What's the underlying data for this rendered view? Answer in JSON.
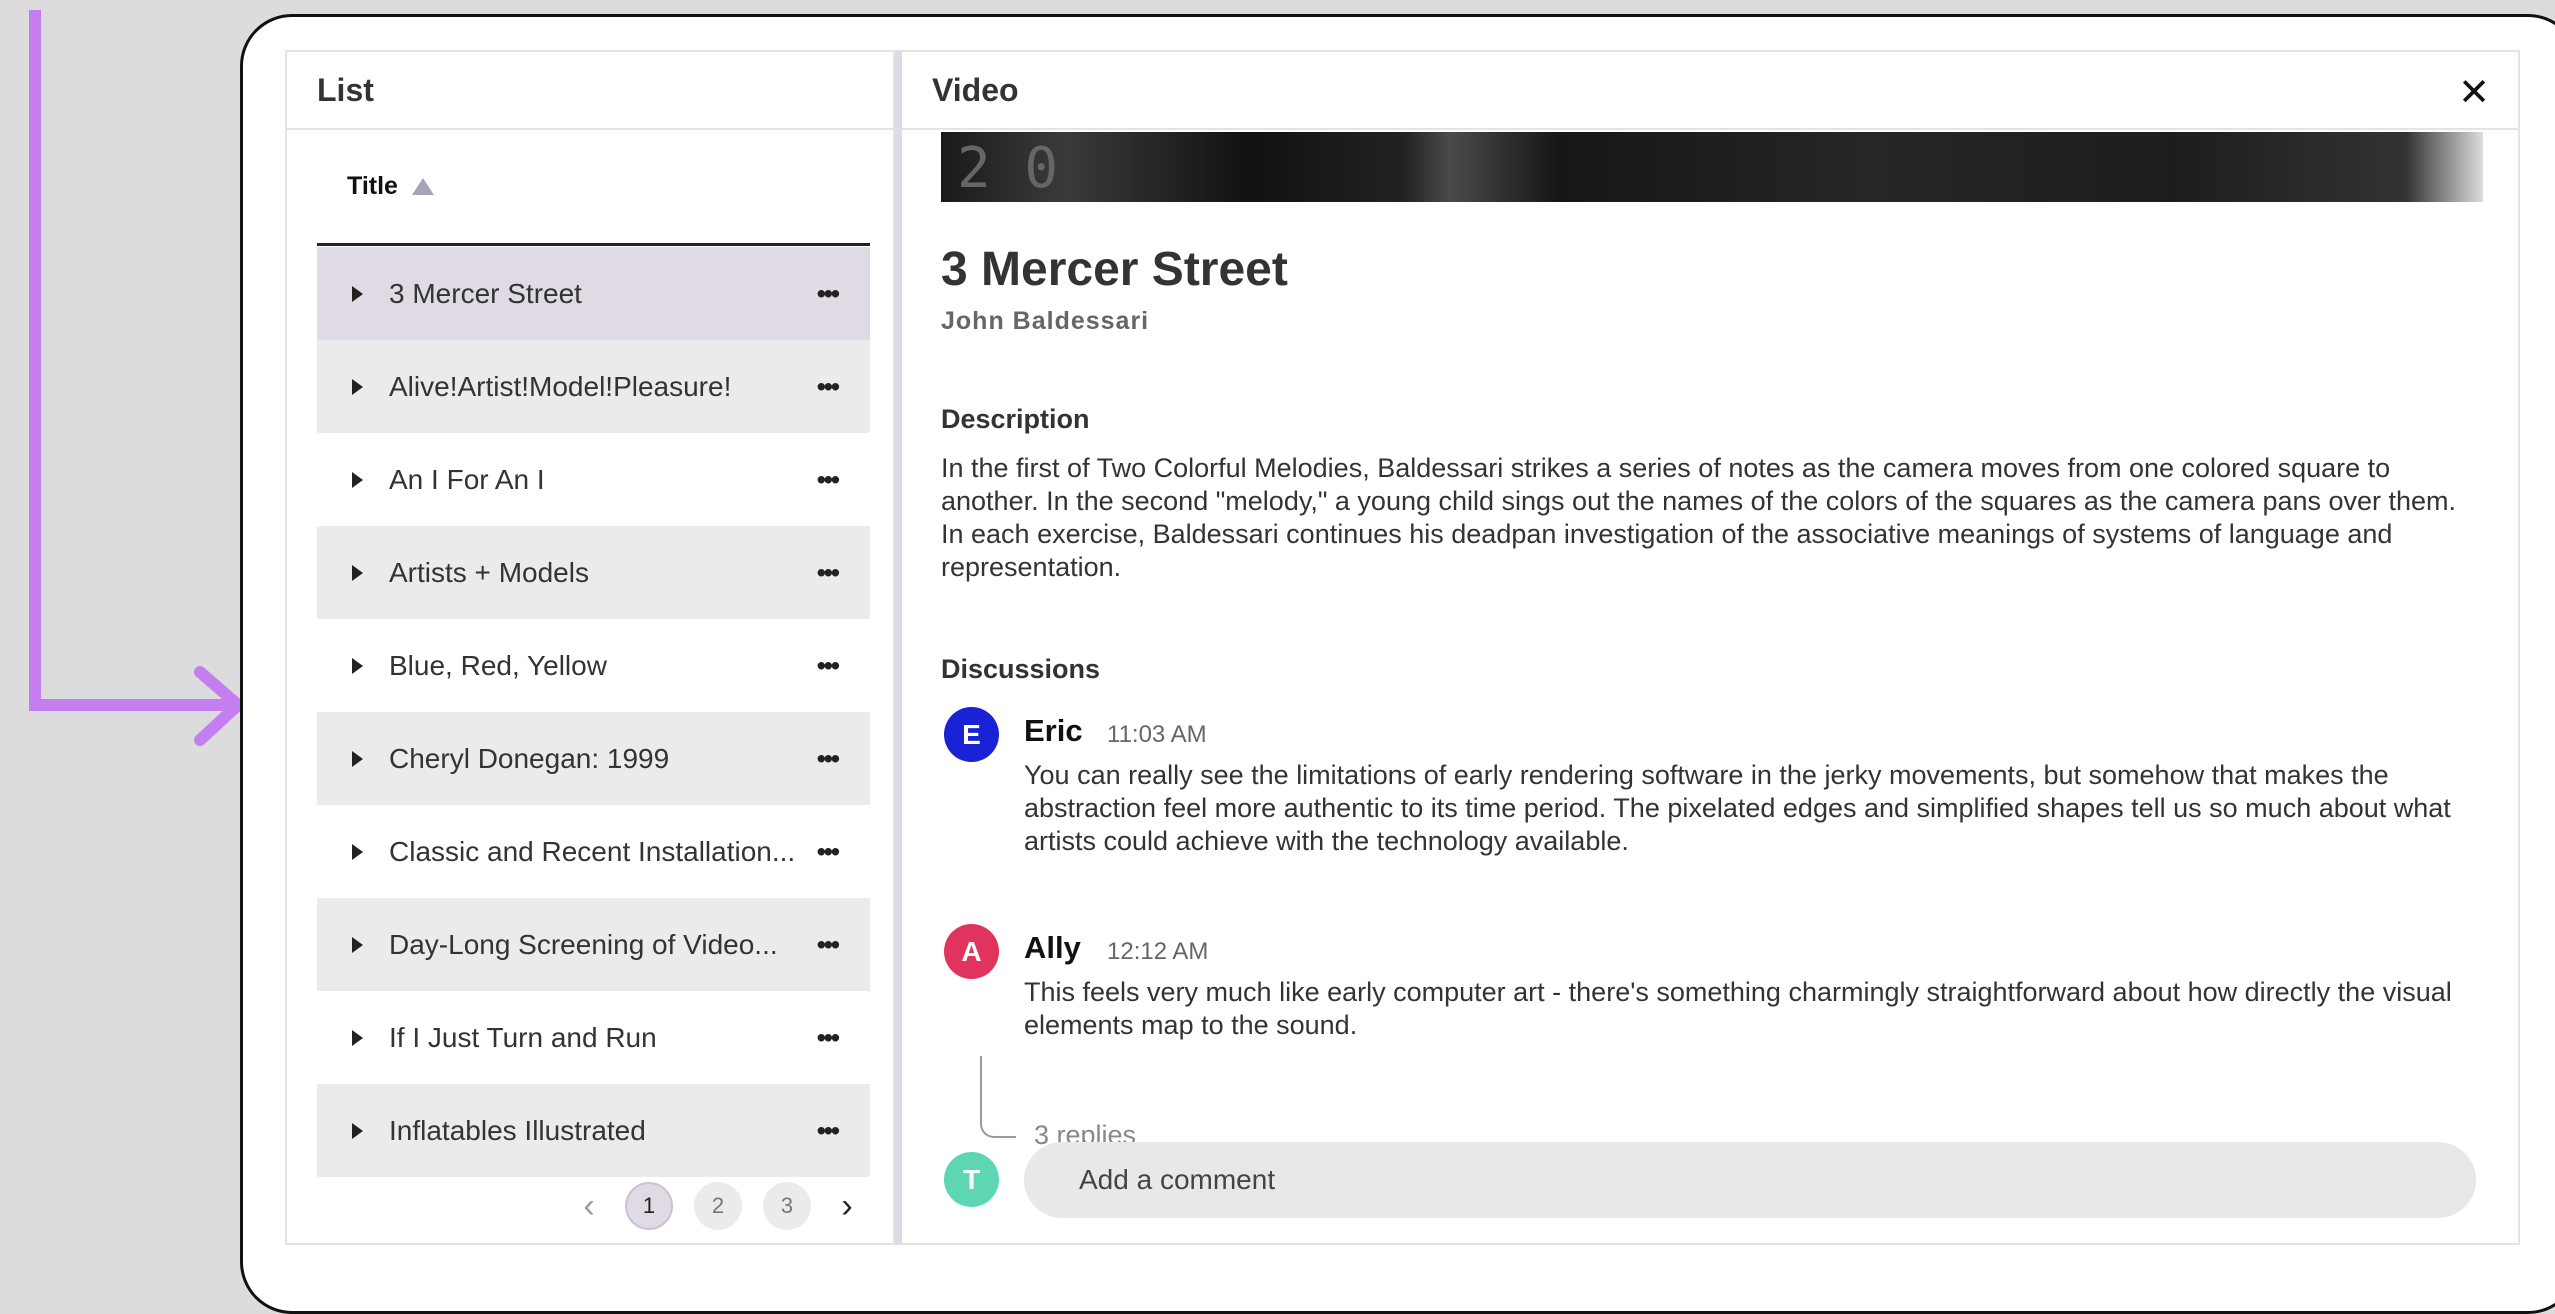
{
  "colors": {
    "arrow": "#c57ef0",
    "selected_row": "#dfdae4",
    "avatar_eric": "#1a22d6",
    "avatar_ally": "#e0345f",
    "avatar_user": "#5fd6b3"
  },
  "list_panel": {
    "title": "List",
    "column_header": "Title",
    "items": [
      {
        "label": "3 Mercer Street",
        "selected": true
      },
      {
        "label": "Alive!Artist!Model!Pleasure!"
      },
      {
        "label": "An I For An I"
      },
      {
        "label": "Artists + Models"
      },
      {
        "label": "Blue, Red, Yellow"
      },
      {
        "label": "Cheryl Donegan: 1999"
      },
      {
        "label": "Classic and Recent Installation..."
      },
      {
        "label": "Day-Long Screening of Video..."
      },
      {
        "label": "If I Just Turn and Run"
      },
      {
        "label": "Inflatables Illustrated"
      }
    ],
    "more_glyph": "•••",
    "pagination": {
      "pages": [
        "1",
        "2",
        "3"
      ],
      "current": "1",
      "prev": "‹",
      "next": "›"
    }
  },
  "video_panel": {
    "title": "Video",
    "close": "✕",
    "thumbnail_text": "2 0",
    "video_title": "3 Mercer Street",
    "artist": "John Baldessari",
    "description_heading": "Description",
    "description": "In the first of Two Colorful Melodies, Baldessari strikes a series of notes as the camera moves from one colored square to another. In the second \"melody,\" a young child sings out the names of the colors of the squares as the camera pans over them. In each exercise, Baldessari continues his deadpan investigation of the associative meanings of systems of language and representation.",
    "discussions_heading": "Discussions",
    "comments": [
      {
        "initial": "E",
        "author": "Eric",
        "time": "11:03 AM",
        "text": "You can really see the limitations of early rendering software in the jerky movements, but somehow that makes the abstraction feel more authentic to its time period. The pixelated edges and simplified shapes tell us so much about what artists could achieve with the technology available."
      },
      {
        "initial": "A",
        "author": "Ally",
        "time": "12:12 AM",
        "text": "This feels very much like early computer art - there's something charmingly straightforward about how directly the visual elements map to the sound.",
        "replies": "3 replies"
      }
    ],
    "current_user_initial": "T",
    "add_comment_placeholder": "Add a comment"
  }
}
